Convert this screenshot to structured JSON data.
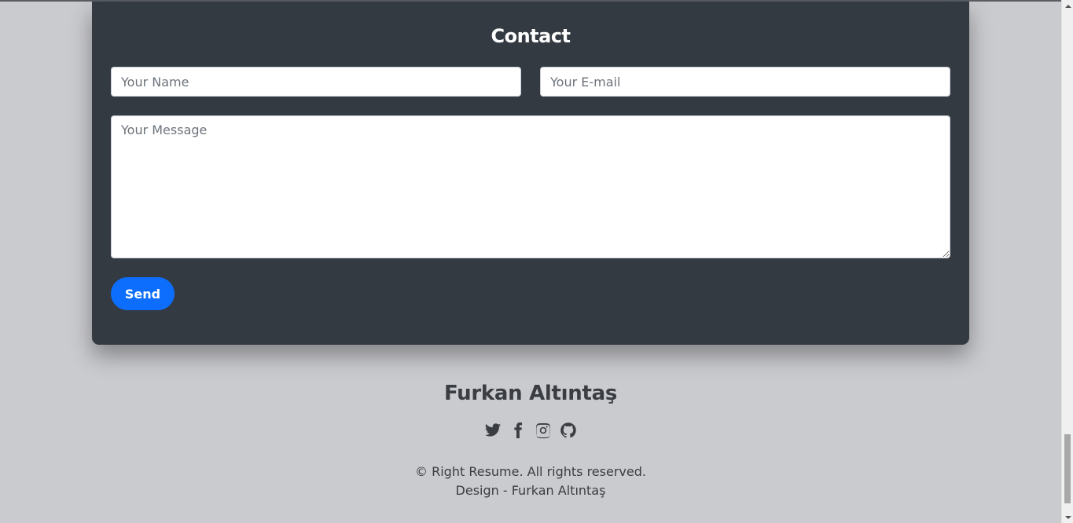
{
  "contact": {
    "title": "Contact",
    "name_placeholder": "Your Name",
    "email_placeholder": "Your E-mail",
    "message_placeholder": "Your Message",
    "send_label": "Send"
  },
  "footer": {
    "name": "Furkan Altıntaş",
    "social": [
      "twitter-icon",
      "facebook-icon",
      "instagram-icon",
      "github-icon"
    ],
    "copyright": "© Right Resume. All rights reserved.",
    "design": "Design - Furkan Altıntaş"
  },
  "colors": {
    "background": "#cacbcf",
    "card": "#343a42",
    "accent": "#0d6efd",
    "text_dark": "#3a3d42"
  }
}
